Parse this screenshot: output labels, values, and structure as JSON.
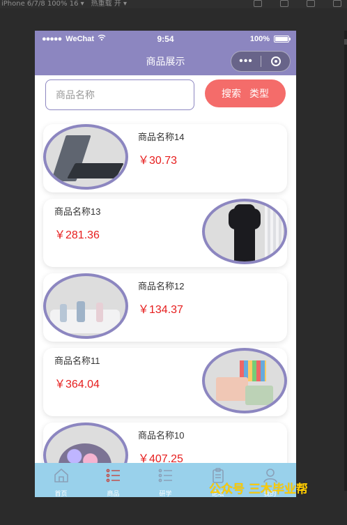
{
  "devtools": {
    "device_text": "iPhone 6/7/8 100% 16 ▾",
    "compile_text": "热重载 开 ▾"
  },
  "statusbar": {
    "signal_text": "●●●●●",
    "carrier": "WeChat",
    "time": "9:54",
    "battery": "100%"
  },
  "navbar": {
    "title": "商品展示",
    "more_label": "•••"
  },
  "search": {
    "placeholder": "商品名称",
    "button_search": "搜索",
    "button_type": "类型"
  },
  "products": [
    {
      "name": "商品名称14",
      "price": "￥30.73",
      "image": "laptop"
    },
    {
      "name": "商品名称13",
      "price": "￥281.36",
      "image": "clothing"
    },
    {
      "name": "商品名称12",
      "price": "￥134.37",
      "image": "bathroom-organizer"
    },
    {
      "name": "商品名称11",
      "price": "￥364.04",
      "image": "desk-organizer"
    },
    {
      "name": "商品名称10",
      "price": "￥407.25",
      "image": "flower-bouquet"
    }
  ],
  "tabbar": {
    "items": [
      {
        "label": "首页",
        "icon": "home-icon",
        "active": false
      },
      {
        "label": "商品",
        "icon": "list-icon",
        "active": true
      },
      {
        "label": "研学",
        "icon": "list-icon",
        "active": false
      },
      {
        "label": "论坛",
        "icon": "clipboard-icon",
        "active": false
      },
      {
        "label": "我的",
        "icon": "user-icon",
        "active": false
      }
    ]
  },
  "watermark": "公众号 三木毕业帮",
  "colors": {
    "nav": "#8c86c0",
    "accent_button": "#f46c6a",
    "price": "#e61d1d",
    "tabbar": "#99d1eb",
    "tab_active": "#c0504d"
  }
}
